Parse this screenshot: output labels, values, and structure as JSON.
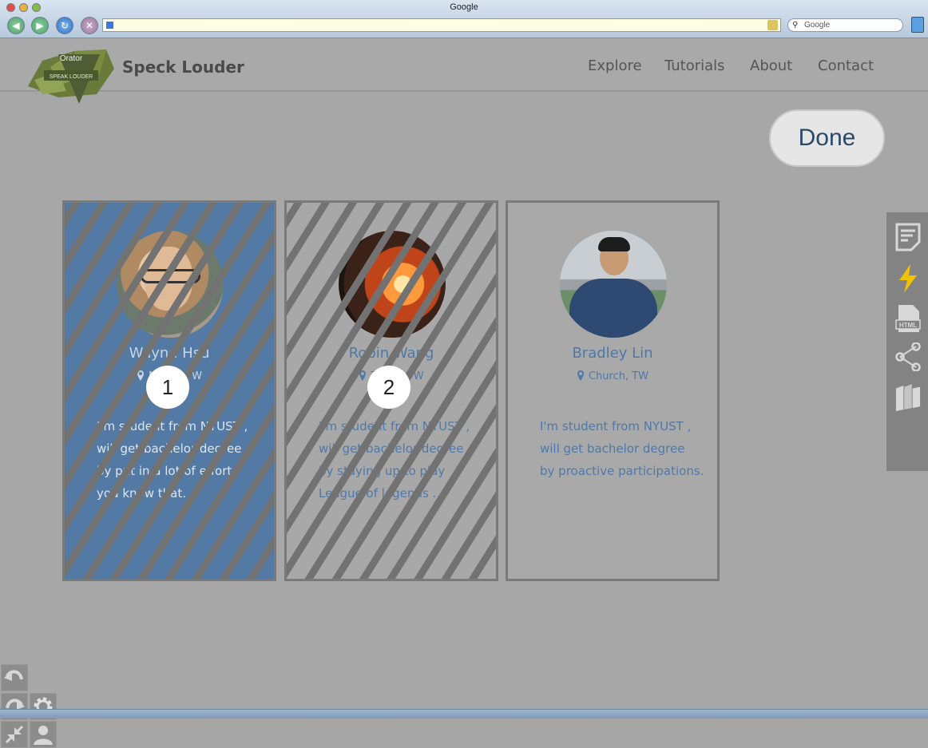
{
  "window": {
    "title": "Google",
    "search_placeholder": "Google"
  },
  "header": {
    "brand": "Speck Louder",
    "logo_text_top": "Orator",
    "logo_text_bottom": "SPEAK LOUDER",
    "nav": [
      "Explore",
      "Tutorials",
      "About",
      "Contact"
    ]
  },
  "actions": {
    "done_label": "Done"
  },
  "cards": [
    {
      "name": "Wayne Hsu",
      "location": "Neihu, TW",
      "bio": [
        "I'm student from NYUST ,",
        "will get bachelor degree",
        "by put in a lot of effort,",
        "you know that."
      ],
      "badge": "1"
    },
    {
      "name": "Robin Wang",
      "location": "Taipei, TW",
      "bio": [
        "I'm student from NYUST ,",
        "will get bachelor degree",
        "by staying up to play",
        "League of legends ."
      ],
      "badge": "2"
    },
    {
      "name": "Bradley Lin",
      "location": "Church, TW",
      "bio": [
        "I'm student from NYUST ,",
        "will get bachelor degree",
        "by proactive participations."
      ]
    }
  ],
  "colors": {
    "accent_blue": "#4f78a8",
    "selected_card": "#527aa4",
    "background": "#a7a7a7",
    "toolbar": "#838383",
    "lightning": "#f2c200"
  },
  "icons": {
    "right_toolbar": [
      "note-add-icon",
      "lightning-icon",
      "html-file-icon",
      "share-icon",
      "books-icon"
    ],
    "bottom_tools": [
      "undo-icon",
      "redo-icon",
      "gear-icon",
      "shrink-icon",
      "user-icon"
    ]
  }
}
